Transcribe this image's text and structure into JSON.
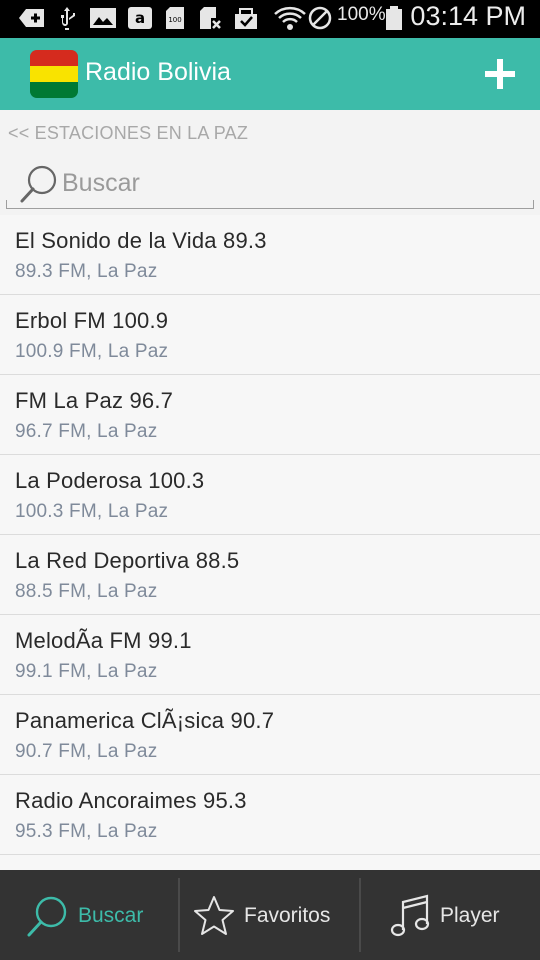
{
  "status_bar": {
    "battery_text": "100%",
    "time": "03:14 PM",
    "icons": [
      "add-icon",
      "usb-icon",
      "image-icon",
      "amazon-icon",
      "sd-card-icon",
      "sim-icon",
      "checklist-icon",
      "wifi-icon",
      "blocked-icon",
      "battery-icon"
    ]
  },
  "app_bar": {
    "title": "Radio Bolivia",
    "flag_colors": [
      "#d52b1e",
      "#f9e300",
      "#007934"
    ],
    "accent": "#3dbba9",
    "add_icon": "plus-icon"
  },
  "back_link": "<< ESTACIONES EN LA PAZ",
  "search": {
    "placeholder": "Buscar",
    "value": ""
  },
  "stations": [
    {
      "name": "El Sonido de la Vida 89.3",
      "subtitle": "89.3 FM, La Paz"
    },
    {
      "name": "Erbol FM 100.9",
      "subtitle": "100.9 FM, La Paz"
    },
    {
      "name": "FM La Paz 96.7",
      "subtitle": "96.7 FM, La Paz"
    },
    {
      "name": "La Poderosa 100.3",
      "subtitle": "100.3 FM, La Paz"
    },
    {
      "name": "La Red Deportiva 88.5",
      "subtitle": "88.5 FM, La Paz"
    },
    {
      "name": "MelodÃ­a FM 99.1",
      "subtitle": "99.1 FM, La Paz"
    },
    {
      "name": "Panamerica ClÃ¡sica 90.7",
      "subtitle": "90.7 FM, La Paz"
    },
    {
      "name": "Radio Ancoraimes 95.3",
      "subtitle": "95.3 FM, La Paz"
    }
  ],
  "bottom_nav": {
    "items": [
      {
        "label": "Buscar",
        "icon": "search-icon",
        "active": true
      },
      {
        "label": "Favoritos",
        "icon": "star-icon",
        "active": false
      },
      {
        "label": "Player",
        "icon": "music-note-icon",
        "active": false
      }
    ],
    "active_color": "#3dbba9",
    "inactive_color": "#e6e6e6"
  }
}
